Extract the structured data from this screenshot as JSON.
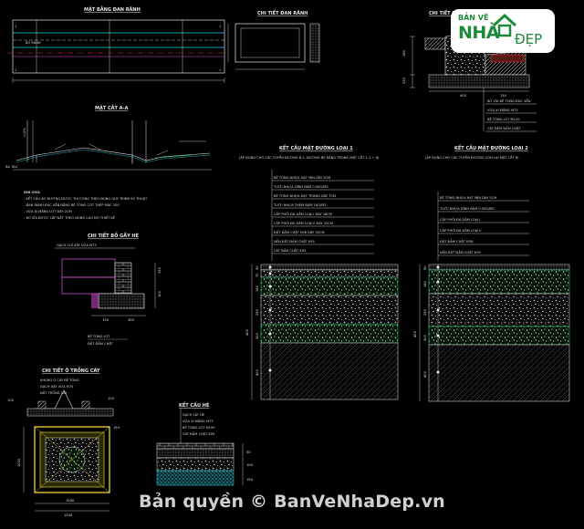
{
  "colors": {
    "background": "#000000",
    "line_white": "#e6e6e6",
    "line_cyan": "#22d6e8",
    "line_red": "#e23a3a",
    "line_magenta": "#d04ad0",
    "line_yellow": "#ffe33a",
    "line_green": "#27c76a",
    "logo_green": "#1c8a3a"
  },
  "logo": {
    "line1": "BẢN VẼ",
    "line2": "NHÀ",
    "line3": "ĐẸP"
  },
  "watermark": "Bản quyền © BanVeNhaDep.vn",
  "drawings": {
    "plan": {
      "title": "MẶT BẰNG ĐAN RÃNH",
      "label": "BỘ RÃNH",
      "section_marks": [
        "1",
        "1",
        "1",
        "1"
      ]
    },
    "section": {
      "title": "MẶT CẮT A-A",
      "left_label": "BA TAU",
      "slope_label": "i=2%"
    },
    "notes": [
      "GHI CHÚ:",
      "- KẾT CẤU ÁO ĐƯỜNG ĐƯỢC THI CÔNG THEO ĐÚNG QUY TRÌNH KỸ THUẬT",
      "- ĐAN RÃNH ĐÚC SẴN BẰNG BÊ TÔNG CỐT THÉP MÁC 200",
      "- VỮA XI MĂNG LÓT DÀY 2CM",
      "- BÓ VỈA ĐƯỢC LẮP ĐẶT THEO ĐÚNG CAO ĐỘ THIẾT KẾ"
    ],
    "slab_detail": {
      "title": "CHI TIẾT ĐAN RÃNH"
    },
    "curb_detail": {
      "title": "CHI TIẾT BÓ VỈA",
      "dims": [
        "180",
        "230",
        "400",
        "150"
      ],
      "labels": [
        "BÓ VỈA BÊ TÔNG ĐÚC SẴN",
        "VỮA XI MĂNG M75",
        "BÊ TÔNG LÓT M100",
        "CÁT ĐỆM ĐẦM CHẶT"
      ]
    },
    "wall_detail": {
      "title": "CHI TIẾT BỒ GẦY HÈ",
      "labels": [
        "GẠCH CHỈ XÂY VỮA M75",
        "BÊ TÔNG LÓT",
        "ĐẤT ĐẦM CHẶT"
      ],
      "dims": [
        "150",
        "100",
        "150",
        "300"
      ]
    },
    "tree_detail": {
      "title": "CHI TIẾT Ô TRỒNG CÂY",
      "labels": [
        "KHUNG Ô CÂY BÊ TÔNG",
        "GẠCH XÂY VỮA M75",
        "ĐẤT TRỒNG CÂY"
      ],
      "dims": [
        "1000",
        "1200",
        "100",
        "100",
        "150"
      ]
    },
    "sidewalk": {
      "title": "KẾT CẤU HÈ",
      "labels": [
        "GẠCH LÁT HÈ",
        "VỮA XI MĂNG M75",
        "BÊ TÔNG LÓT M100",
        "CÁT ĐẦM CHẶT K95"
      ],
      "dims": [
        "50",
        "100",
        "150"
      ]
    },
    "pavement_1": {
      "title": "KẾT CẤU MẶT ĐƯỜNG LOẠI 1",
      "subtitle": "(ÁP DỤNG CHO CÁC TUYẾN ĐƯỜNG B-1, ĐƯỜNG BE RÂNG TRONG MẶT CẮT 1-1 ÷ 6)",
      "layers": [
        "BÊ TÔNG NHỰA HẠT MỊN DÀY 5CM",
        "TƯỚI NHỰA DÍNH BÁM 0.5KG/M2",
        "BÊ TÔNG NHỰA HẠT TRUNG DÀY 7CM",
        "TƯỚI NHỰA THẤM BÁM 1KG/M2",
        "CẤP PHỐI ĐÁ DĂM LOẠI I DÀY 18CM",
        "CẤP PHỐI ĐÁ DĂM LOẠI II DÀY 25CM",
        "ĐẤT ĐẦM CHẶT K98 DÀY 30CM",
        "NỀN ĐẤT ĐẦM CHẶT K95",
        "CÁT ĐẦM CHẶT K95"
      ],
      "dims": [
        "50",
        "70",
        "180",
        "250",
        "300",
        "400"
      ]
    },
    "pavement_2": {
      "title": "KẾT CẤU MẶT ĐƯỜNG LOẠI 2",
      "subtitle": "(ÁP DỤNG CHO CÁC TUYẾN ĐƯỜNG CÒN LẠI MẶT CẮT 6)",
      "layers": [
        "BÊ TÔNG NHỰA HẠT MỊN DÀY 5CM",
        "TƯỚI NHỰA DÍNH BÁM 0.5KG/M2",
        "CẤP PHỐI ĐÁ DĂM LOẠI I",
        "CẤP PHỐI ĐÁ DĂM LOẠI II",
        "ĐẤT ĐẦM CHẶT K98",
        "NỀN ĐẤT ĐẦM CHẶT K95"
      ],
      "dims": [
        "50",
        "180",
        "250",
        "300",
        "400"
      ]
    }
  }
}
